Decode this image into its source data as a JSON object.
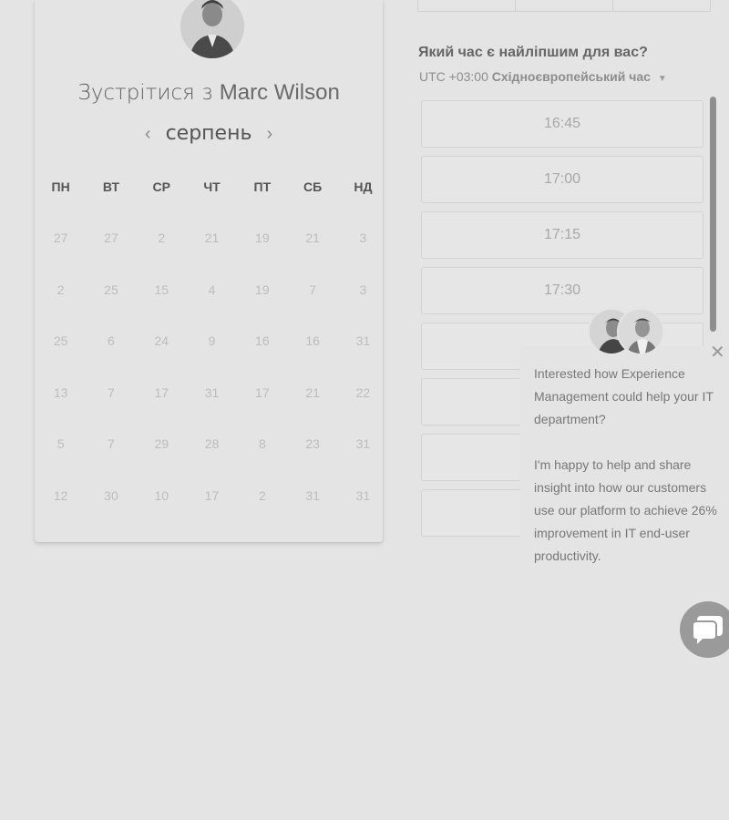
{
  "meeting": {
    "title_prefix": "Зустрітися з",
    "host": "Marc Wilson"
  },
  "calendar": {
    "month": "серпень",
    "prev_icon": "chevron-left-icon",
    "next_icon": "chevron-right-icon",
    "weekdays": [
      "ПН",
      "ВТ",
      "СР",
      "ЧТ",
      "ПТ",
      "СБ",
      "НД"
    ],
    "weeks": [
      [
        {
          "d": "27",
          "a": false
        },
        {
          "d": "27",
          "a": false
        },
        {
          "d": "2",
          "a": true
        },
        {
          "d": "21",
          "a": false
        },
        {
          "d": "19",
          "a": false
        },
        {
          "d": "21",
          "a": false
        },
        {
          "d": "3",
          "a": false
        }
      ],
      [
        {
          "d": "2",
          "a": false
        },
        {
          "d": "25",
          "a": false
        },
        {
          "d": "15",
          "a": false
        },
        {
          "d": "4",
          "a": false
        },
        {
          "d": "19",
          "a": false
        },
        {
          "d": "7",
          "a": false
        },
        {
          "d": "3",
          "a": false
        }
      ],
      [
        {
          "d": "25",
          "a": false
        },
        {
          "d": "6",
          "a": true
        },
        {
          "d": "24",
          "a": false
        },
        {
          "d": "9",
          "a": true
        },
        {
          "d": "16",
          "a": false
        },
        {
          "d": "16",
          "a": false
        },
        {
          "d": "31",
          "a": true
        }
      ],
      [
        {
          "d": "13",
          "a": false
        },
        {
          "d": "7",
          "a": true
        },
        {
          "d": "17",
          "a": false
        },
        {
          "d": "31",
          "a": false
        },
        {
          "d": "17",
          "a": true,
          "selected": true
        },
        {
          "d": "21",
          "a": false
        },
        {
          "d": "22",
          "a": false
        }
      ],
      [
        {
          "d": "5",
          "a": true
        },
        {
          "d": "7",
          "a": false
        },
        {
          "d": "29",
          "a": false
        },
        {
          "d": "28",
          "a": false
        },
        {
          "d": "8",
          "a": false
        },
        {
          "d": "23",
          "a": true
        },
        {
          "d": "31",
          "a": false
        }
      ],
      [
        {
          "d": "12",
          "a": false
        },
        {
          "d": "30",
          "a": true
        },
        {
          "d": "10",
          "a": false
        },
        {
          "d": "17",
          "a": true
        },
        {
          "d": "2",
          "a": false
        },
        {
          "d": "31",
          "a": false
        },
        {
          "d": "31",
          "a": false
        }
      ]
    ]
  },
  "times": {
    "question": "Який час є найліпшим для вас?",
    "timezone_offset": "UTC +03:00",
    "timezone_name": "Східноєвропейський час",
    "slots": [
      "16:45",
      "17:00",
      "17:15",
      "17:30",
      "",
      "",
      "",
      ""
    ]
  },
  "chat": {
    "message_1": "Interested how Experience Management could help your IT department?",
    "message_2": "I'm happy to help and share insight into how our customers use our platform to achieve 26% improvement in IT end-user productivity."
  },
  "colors": {
    "background": "#e4e4e4",
    "selected_day": "#6b6b6b"
  }
}
